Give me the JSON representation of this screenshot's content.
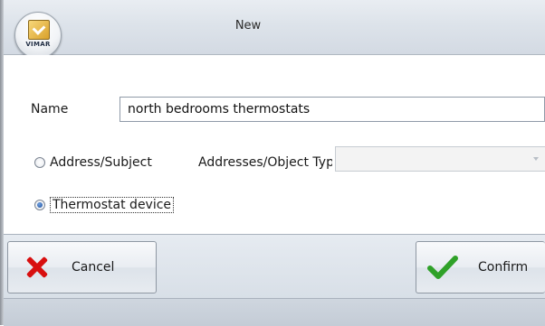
{
  "window": {
    "title": "New",
    "logo_text": "VIMAR"
  },
  "form": {
    "name_label": "Name",
    "name_value": "north bedrooms thermostats",
    "radio_address_label": "Address/Subject",
    "radio_address_checked": false,
    "addresses_label": "Addresses/Object Type",
    "addresses_value": "",
    "addresses_enabled": false,
    "radio_thermostat_label": "Thermostat device",
    "radio_thermostat_checked": true
  },
  "buttons": {
    "cancel_label": "Cancel",
    "confirm_label": "Confirm"
  },
  "icons": {
    "logo": "vimar-logo-icon",
    "cancel": "red-x-icon",
    "confirm": "green-check-icon"
  },
  "colors": {
    "cancel_icon": "#d80f0f",
    "confirm_icon": "#2fa128",
    "radio_selected": "#1d4f9c"
  }
}
